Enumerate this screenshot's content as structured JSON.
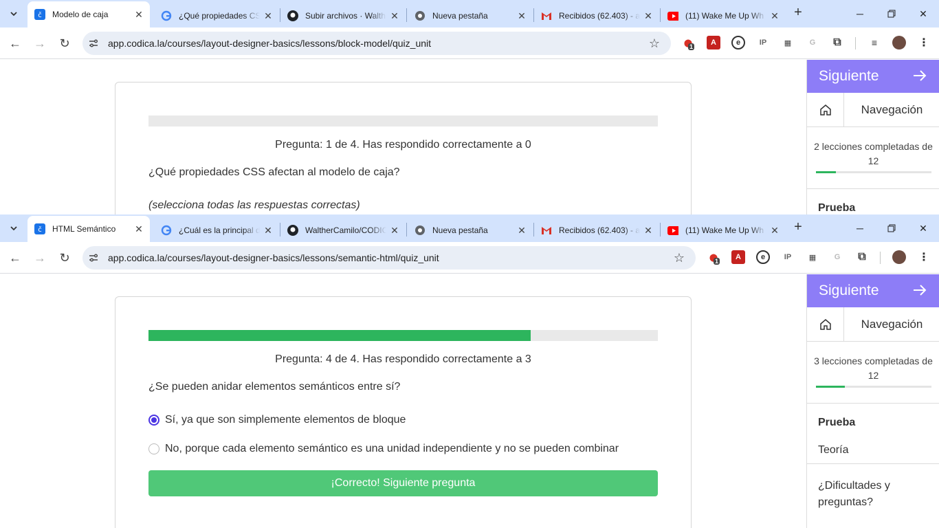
{
  "windows": [
    {
      "tabs": [
        {
          "title": "Modelo de caja",
          "favicon": "codica-icon",
          "active": true
        },
        {
          "title": "¿Qué propiedades CSS",
          "favicon": "google-icon"
        },
        {
          "title": "Subir archivos · Walth",
          "favicon": "github-icon"
        },
        {
          "title": "Nueva pestaña",
          "favicon": "chrome-icon"
        },
        {
          "title": "Recibidos (62.403) - a",
          "favicon": "gmail-icon"
        },
        {
          "title": "(11) Wake Me Up Wh",
          "favicon": "youtube-icon"
        }
      ],
      "url": "app.codica.la/courses/layout-designer-basics/lessons/block-model/quiz_unit",
      "extension_badge": "1",
      "quiz": {
        "progress_percent": 0,
        "meta": "Pregunta: 1 de 4. Has respondido correctamente a 0",
        "question": "¿Qué propiedades CSS afectan al modelo de caja?",
        "hint": "(selecciona todas las respuestas correctas)"
      },
      "sidebar": {
        "next_label": "Siguiente",
        "nav_label": "Navegación",
        "completed": "2 lecciones completadas de 12",
        "completed_fraction": 0.17,
        "section": "Prueba"
      }
    },
    {
      "tabs": [
        {
          "title": "HTML Semántico",
          "favicon": "codica-icon",
          "active": true
        },
        {
          "title": "¿Cuál es la principal d",
          "favicon": "google-icon"
        },
        {
          "title": "WaltherCamilo/CODIC",
          "favicon": "github-icon"
        },
        {
          "title": "Nueva pestaña",
          "favicon": "chrome-icon"
        },
        {
          "title": "Recibidos (62.403) - a",
          "favicon": "gmail-icon"
        },
        {
          "title": "(11) Wake Me Up Wh",
          "favicon": "youtube-icon"
        }
      ],
      "url": "app.codica.la/courses/layout-designer-basics/lessons/semantic-html/quiz_unit",
      "extension_badge": "1",
      "quiz": {
        "progress_percent": 75,
        "meta": "Pregunta: 4 de 4. Has respondido correctamente a 3",
        "question": "¿Se pueden anidar elementos semánticos entre sí?",
        "options": [
          {
            "label": "Sí, ya que son simplemente elementos de bloque",
            "selected": true
          },
          {
            "label": "No, porque cada elemento semántico es una unidad independiente y no se pueden combinar",
            "selected": false
          }
        ],
        "button": "¡Correcto! Siguiente pregunta"
      },
      "sidebar": {
        "next_label": "Siguiente",
        "nav_label": "Navegación",
        "completed": "3 lecciones completadas de 12",
        "completed_fraction": 0.25,
        "section": "Prueba",
        "theory": "Teoría",
        "help": "¿Dificultades y preguntas?"
      }
    }
  ],
  "colors": {
    "tabstrip": "#d3e3fd",
    "accent_purple": "#8d7df7",
    "progress_green": "#2db55d",
    "button_green": "#50c878",
    "radio_selected": "#4b35e3"
  }
}
